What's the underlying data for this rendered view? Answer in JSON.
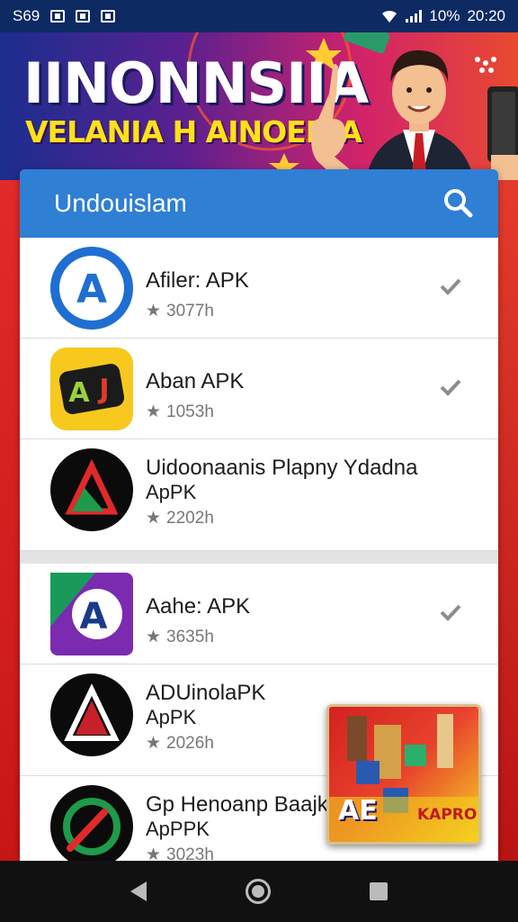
{
  "status_bar": {
    "left_text": "S69",
    "battery": "10%",
    "time": "20:20"
  },
  "banner": {
    "title": "IINONNSIIA",
    "subtitle": "VELANIA H AINOEDIA"
  },
  "search": {
    "title": "Undouislam"
  },
  "apps": [
    {
      "name": "Afiler: APK",
      "meta": "3077h",
      "checked": true
    },
    {
      "name": "Aban APK",
      "meta": "1053h",
      "checked": true
    },
    {
      "name": "Uidoonaanis Plapny Ydadna",
      "name2": "ApPK",
      "meta": "2202h",
      "checked": false
    },
    {
      "name": "Aahe: APK",
      "meta": "3635h",
      "checked": true
    },
    {
      "name": "ADUinolaPK",
      "name2": "ApPK",
      "meta": "2026h",
      "checked": false
    },
    {
      "name": "Gp Henoanp Baajk",
      "name2": "ApPPK",
      "meta": "3023h",
      "checked": false
    }
  ],
  "ad": {
    "label_left": "AE",
    "label_right": "KAPRO"
  },
  "colors": {
    "accent": "#2f7fd4",
    "statusbar": "#0d2a63",
    "background": "#c81e1e"
  }
}
